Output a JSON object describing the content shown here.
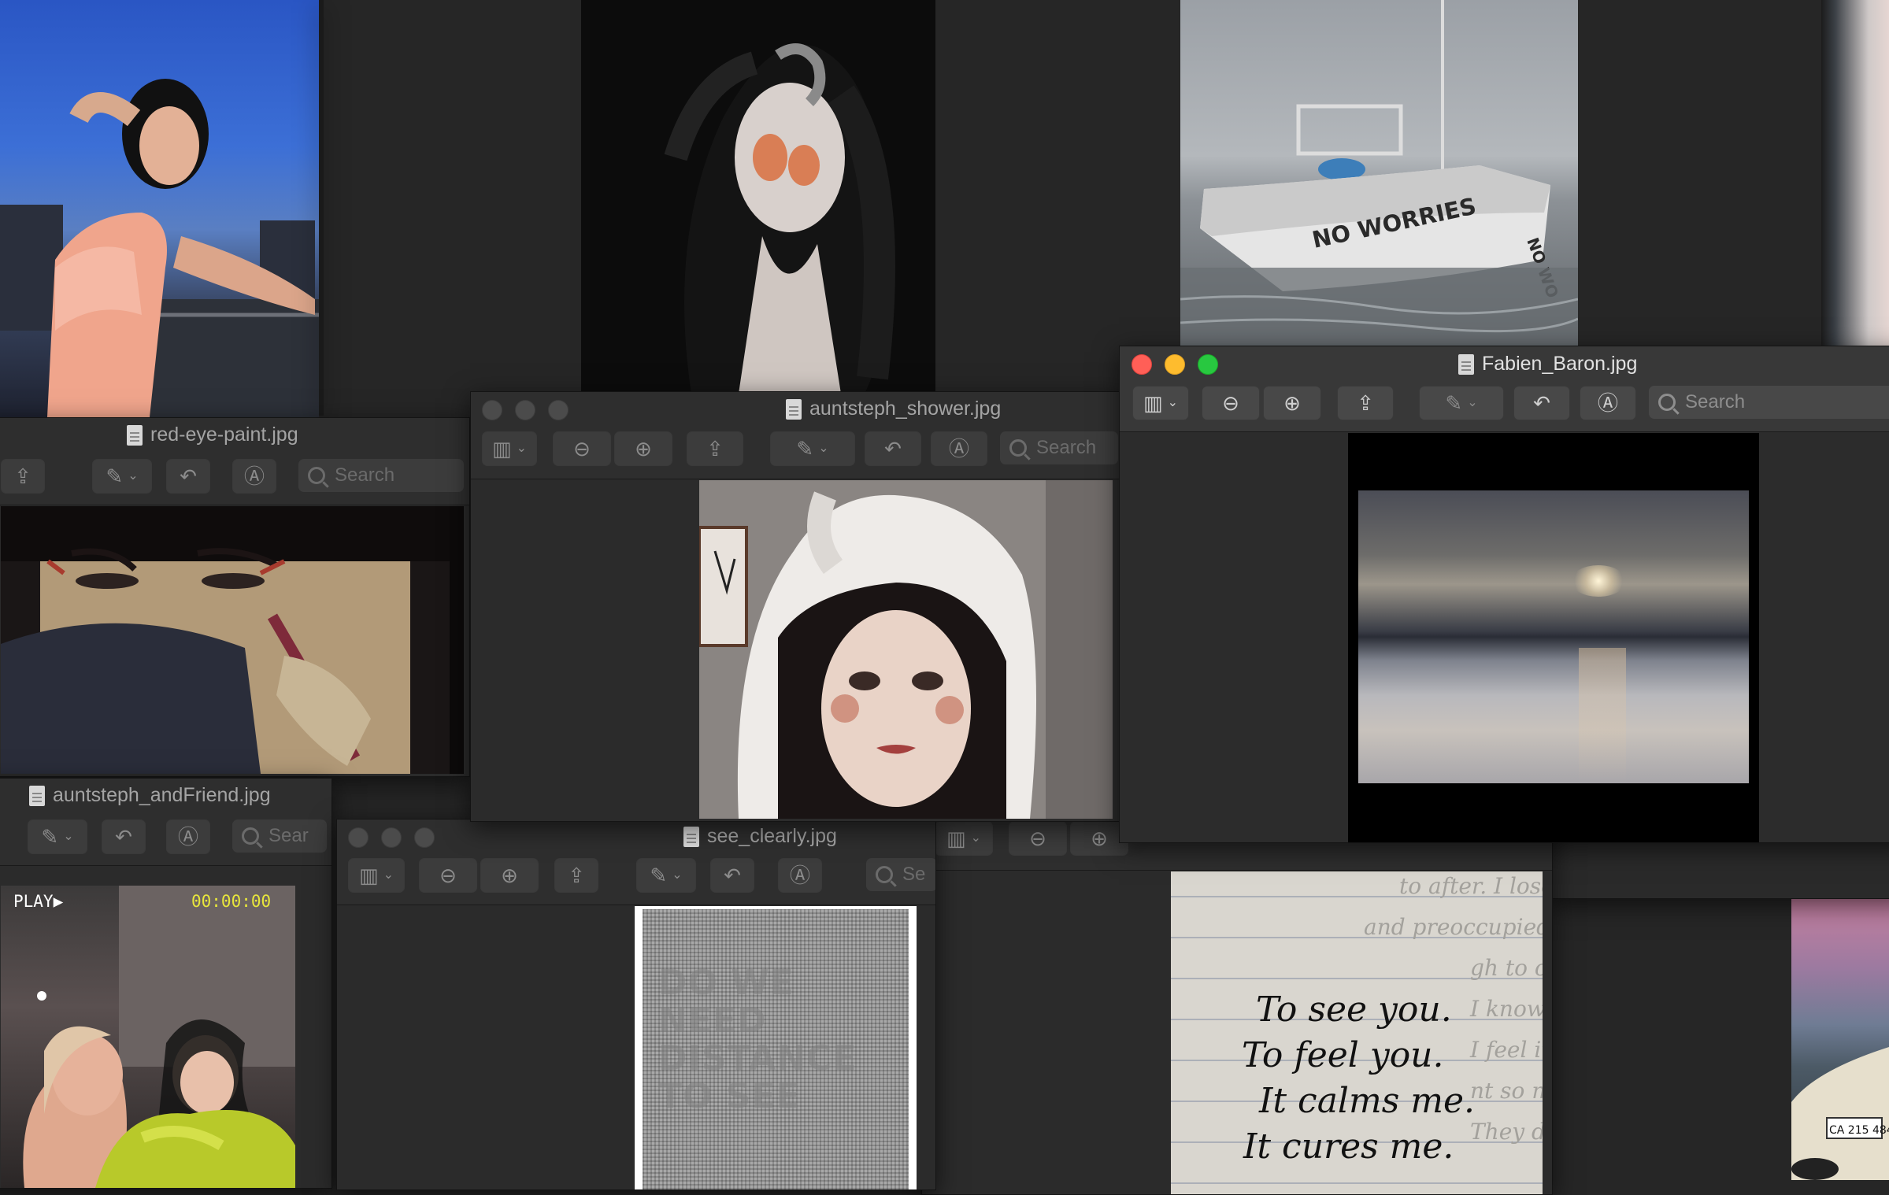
{
  "windows": {
    "fabien": {
      "title": "Fabien_Baron.jpg",
      "search": "Search"
    },
    "shower": {
      "title": "auntsteph_shower.jpg",
      "search": "Search"
    },
    "redeye": {
      "title": "red-eye-paint.jpg",
      "search": "Search"
    },
    "friend": {
      "title": "auntsteph_andFriend.jpg",
      "search": "Sear"
    },
    "clearly": {
      "title": "see_clearly.jpg",
      "search": "Se"
    }
  },
  "boat": {
    "hull_text": "NO WORRIES",
    "bow_text": "NO WO"
  },
  "vhs": {
    "play": "PLAY▶",
    "time": "00:00:00"
  },
  "handwriting": {
    "bg_lines": [
      "to after. I lose s",
      "and preoccupied",
      "gh to operr.",
      "I know the kni",
      "I feel it lurk",
      "nt so much",
      "They don't"
    ],
    "lines": [
      "To see you.",
      "To feel you.",
      "It calms me.",
      "It cures me."
    ]
  },
  "poster_text": {
    "lines": [
      "DO WE",
      "NEED",
      "DISTANCE",
      "TO SEE"
    ]
  },
  "plate": "CA 215 484",
  "icons": {
    "sidebar": "sidebar-icon",
    "zoom_out": "zoom-out-icon",
    "zoom_in": "zoom-in-icon",
    "share": "share-icon",
    "markup": "markup-pen-icon",
    "rotate": "rotate-icon",
    "annotate": "annotate-icon",
    "search": "search-icon",
    "document": "document-icon"
  }
}
